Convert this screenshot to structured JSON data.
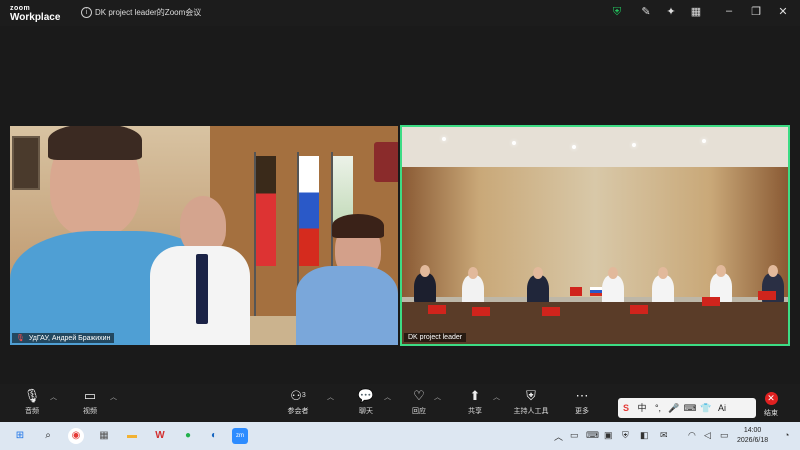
{
  "titlebar": {
    "logo_line1": "zoom",
    "logo_line2": "Workplace",
    "info_icon": "info-icon",
    "meeting_title": "DK project leader的Zoom会议"
  },
  "video": {
    "left_participant": "УдГАУ, Андрей Бражихин",
    "right_participant": "DK project leader"
  },
  "toolbar": {
    "audio": "音频",
    "video": "视频",
    "participants": "参会者",
    "participants_count": "3",
    "chat": "聊天",
    "reactions": "回应",
    "share": "共享",
    "host_tools": "主持人工具",
    "more": "更多",
    "end": "结束"
  },
  "ime": {
    "items": [
      "S",
      "中",
      "°,",
      "🎤",
      "⌨",
      "👕",
      "Ai"
    ]
  },
  "taskbar": {
    "time": "14:00",
    "date": "2026/6/18"
  },
  "colors": {
    "active_speaker_border": "#3ddc84",
    "end_button": "#e02020",
    "shield": "#22c55e"
  }
}
